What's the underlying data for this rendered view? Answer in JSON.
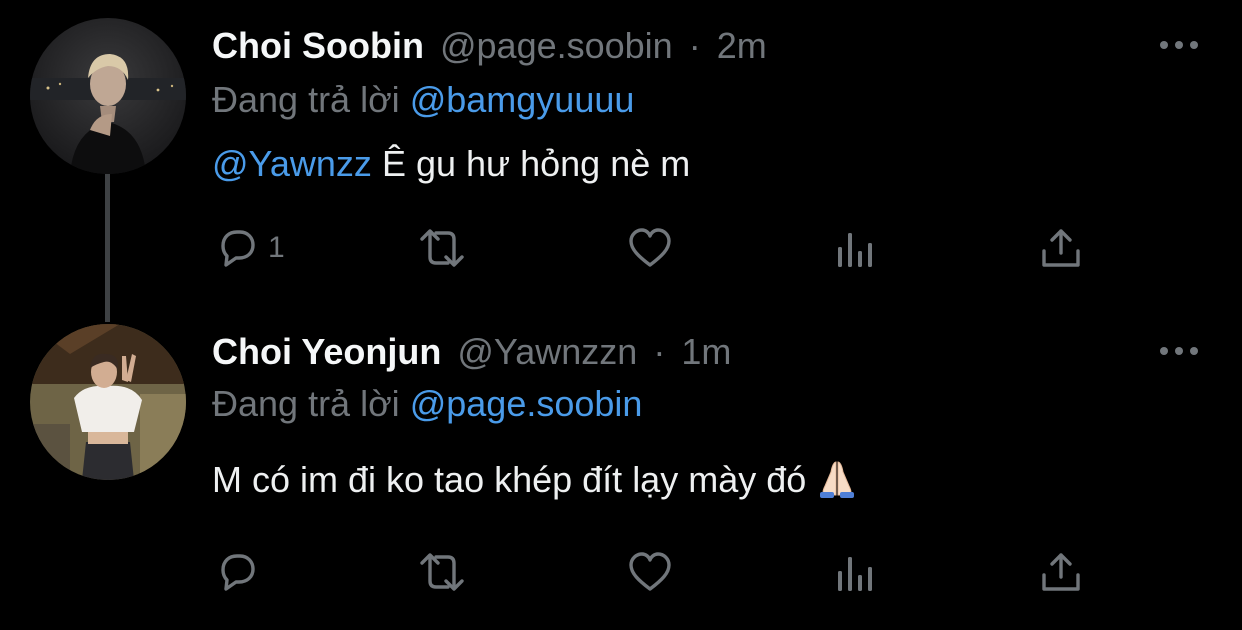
{
  "tweets": [
    {
      "display_name": "Choi Soobin",
      "handle": "@page.soobin",
      "separator": "·",
      "time": "2m",
      "replying_prefix": "Đang trả lời",
      "replying_to": "@bamgyuuuu",
      "body_mention": "@Yawnzz",
      "body_text": " Ê gu hư hỏng nè m",
      "reply_count": "1",
      "icons": {
        "more": "more-dots-icon",
        "reply": "reply-bubble-icon",
        "retweet": "retweet-icon",
        "like": "heart-icon",
        "views": "views-bar-chart-icon",
        "share": "share-upload-icon"
      }
    },
    {
      "display_name": "Choi Yeonjun",
      "handle": "@Yawnzzn",
      "separator": "·",
      "time": "1m",
      "replying_prefix": "Đang trả lời",
      "replying_to": "@page.soobin",
      "body_text": "M có im đi ko tao khép đít lạy mày đó ",
      "body_emoji": "folded-hands-emoji",
      "icons": {
        "more": "more-dots-icon",
        "reply": "reply-bubble-icon",
        "retweet": "retweet-icon",
        "like": "heart-icon",
        "views": "views-bar-chart-icon",
        "share": "share-upload-icon"
      }
    }
  ],
  "colors": {
    "background": "#000000",
    "text_primary": "#e7e9ea",
    "text_secondary": "#71767b",
    "mention": "#4a9be9",
    "thread_line": "#3e4144"
  }
}
